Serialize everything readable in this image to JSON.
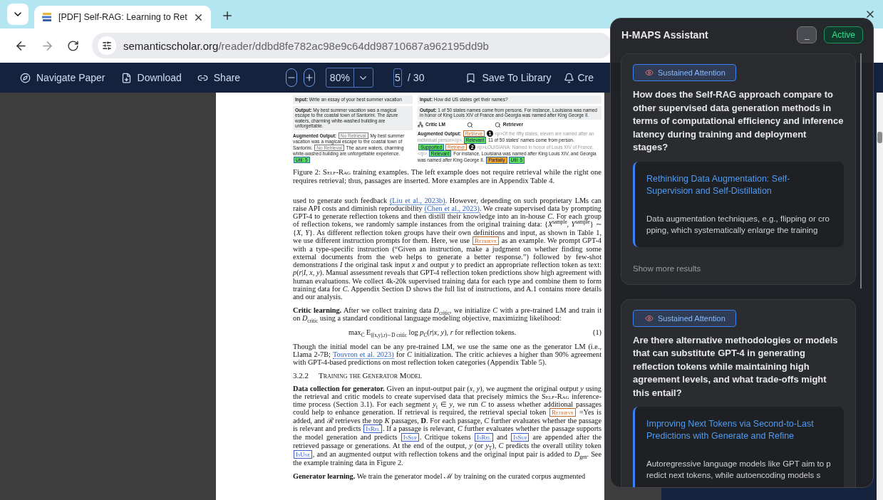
{
  "browser": {
    "tabs": [
      {
        "title": "[PDF] Self-RAG: Learning to Ret",
        "selected": true
      }
    ],
    "url_host": "semanticscholar.org",
    "url_path": "/reader/ddbd8fe782ac98e9c64dd98710687a962195dd9b"
  },
  "toolbar": {
    "left": [
      {
        "kind": "compass",
        "label": "Navigate Paper"
      },
      {
        "kind": "download",
        "label": "Download"
      },
      {
        "kind": "link",
        "label": "Share"
      }
    ],
    "zoom": "80%",
    "page": "5",
    "page_total": "/ 30",
    "right": [
      {
        "kind": "bookmark",
        "label": "Save To Library"
      },
      {
        "kind": "bell",
        "label": "Cre"
      }
    ]
  },
  "paper": {
    "figure": {
      "columns": [
        {
          "input": "**Input:** Write an essay of your best summer vacation",
          "output": "**Output:** My best summer vacation was a magical escape to the coastal town of Santorini. The azure waters, charming white-washed building are unforgettable.",
          "augmented": [
            {
              "kind": "text",
              "text": "**Augmented Output:** "
            },
            {
              "kind": "token",
              "text": "No Retrieval",
              "color": "#777777",
              "filled": false
            },
            {
              "kind": "text",
              "text": " My best summer vacation was a magical escape to the coastal town of Santorini. "
            },
            {
              "kind": "token",
              "text": "No Retrieval",
              "color": "#777777",
              "filled": false
            },
            {
              "kind": "text",
              "text": " The azure waters, charming white-washed building are unforgettable experience. "
            },
            {
              "kind": "token",
              "text": "Util: 5",
              "color": "#5fe35f",
              "filled": true
            }
          ]
        },
        {
          "input": "**Input:** How did US states get their names?",
          "output": "**Output:** 1 of 50 states names come from persons. For instance, Louisiana was named in honor of King Louis XIV of France and Georgia was named after King George II.",
          "labels": [
            {
              "kind": "critic",
              "text": "Critic LM"
            },
            {
              "kind": "retriever"
            },
            {
              "kind": "retriever",
              "text": "Retriever"
            }
          ],
          "augmented": [
            {
              "kind": "text",
              "text": "**Augmented Output:** "
            },
            {
              "kind": "token",
              "text": "Retrieve",
              "color": "#c46a2b",
              "filled": false
            },
            {
              "kind": "marker",
              "text": "1"
            },
            {
              "kind": "passage",
              "text": "<p>Of the fifty states, eleven are named after an individual person</p>."
            },
            {
              "kind": "token",
              "text": "Relevant",
              "color": "#5fe35f",
              "filled": true
            },
            {
              "kind": "text",
              "text": " 11 of 50 states' names come from person. "
            },
            {
              "kind": "token",
              "text": "Supported",
              "color": "#5fe35f",
              "filled": true
            },
            {
              "kind": "token",
              "text": "Retrieve",
              "color": "#c46a2b",
              "filled": false
            },
            {
              "kind": "marker",
              "text": "2"
            },
            {
              "kind": "passage",
              "text": "<p>LOUISIANA: Named in honor of Louis XIV of France.</p>."
            },
            {
              "kind": "token",
              "text": "Relevant",
              "color": "#5fe35f",
              "filled": true
            },
            {
              "kind": "text",
              "text": " For instance, Louisiana was named after King Louis XIV, and Georgia was named after King George II. "
            },
            {
              "kind": "token",
              "text": "Partially",
              "color": "#f5a623",
              "filled": true
            },
            {
              "kind": "token",
              "text": "Util: 5",
              "color": "#5fe35f",
              "filled": true
            }
          ]
        }
      ]
    },
    "blocks": [
      {
        "kind": "caption",
        "segments": [
          {
            "kind": "text",
            "text": "Figure 2: "
          },
          {
            "kind": "smallcaps",
            "text": "Self-Rag"
          },
          {
            "kind": "text",
            "text": " training examples. The left example does not require retrieval while the right one requires retrieval; thus, passages are inserted. More examples are in Appendix Table 4."
          }
        ]
      },
      {
        "kind": "body",
        "segments": [
          {
            "kind": "text",
            "text": "used to generate such feedback "
          },
          {
            "kind": "link",
            "text": "(Liu et al., 2023b)"
          },
          {
            "kind": "text",
            "text": ". However, depending on such proprietary LMs can raise API costs and diminish reproducibility "
          },
          {
            "kind": "link",
            "text": "(Chen et al., 2023)"
          },
          {
            "kind": "text",
            "text": ". We create supervised data by prompting GPT-4 to generate reflection tokens and then distill their knowledge into an in-house *C*. For each group of reflection tokens, we randomly sample instances from the original training data: {*X*$^{sample}$, *Y*$^{sample}$} ∼ {*X*, *Y*}. As different reflection token groups have their own definitions and input, as shown in Table 1, we use different instruction prompts for them. Here, we use "
          },
          {
            "kind": "token",
            "text": "Retrieve",
            "color": "#c46a2b"
          },
          {
            "kind": "text",
            "text": " as an example. We prompt GPT-4 with a type-specific instruction (“Given an instruction, make a judgment on whether finding some external documents from the web helps to generate a better response.”) followed by few-shot demonstrations *I* the original task input *x* and output *y* to predict an appropriate reflection token as text: *p*(*r*|*I*, *x*, *y*). Manual assessment reveals that GPT-4 reflection token predictions show high agreement with human evaluations. We collect 4k-20k supervised training data for each type and combine them to form training data for *C*. Appendix Section D shows the full list of instructions, and A.1 contains more details and our analysis."
          }
        ]
      },
      {
        "kind": "body",
        "segments": [
          {
            "kind": "text",
            "text": "**Critic learning.**  After we collect training data *D*$_{critic}$, we initialize *C* with a pre-trained LM and train it on *D*$_{critic}$ using a standard conditional language modeling objective, maximizing likelihood:"
          }
        ]
      },
      {
        "kind": "equation",
        "text": "max$_{C}$ E$_{((x,y),r)∼D critic}$ log *p*$_{C}$(*r*|*x*, *y*),  *r* for reflection tokens.",
        "number": "(1)"
      },
      {
        "kind": "body",
        "segments": [
          {
            "kind": "text",
            "text": "Though the initial model can be any pre-trained LM, we use the same one as the generator LM (i.e., Llama 2-7B; "
          },
          {
            "kind": "link",
            "text": "Touvron et al. 2023)"
          },
          {
            "kind": "text",
            "text": " for *C* initialization. The critic achieves a higher than 90% agreement with GPT-4-based predictions on most reflection token categories (Appendix Table 5)."
          }
        ]
      },
      {
        "kind": "heading",
        "number": "3.2.2",
        "text": "Training the Generator Model"
      },
      {
        "kind": "body",
        "segments": [
          {
            "kind": "text",
            "text": "**Data collection for generator.**  Given an input-output pair (*x*, *y*), we augment the original output *y* using the retrieval and critic models to create supervised data that precisely mimics the "
          },
          {
            "kind": "smallcaps",
            "text": "Self-Rag"
          },
          {
            "kind": "text",
            "text": " inference-time process (Section 3.1). For each segment *y*$_{t}$ ∈ *y*, we run *C* to assess whether additional passages could help to enhance generation. If retrieval is required, the retrieval special token "
          },
          {
            "kind": "token",
            "text": "Retrieve",
            "color": "#c46a2b"
          },
          {
            "kind": "text",
            "text": " =Yes is added, and ℛ retrieves the top *K* passages, **D**. For each passage, *C* further evaluates whether the passage is relevant and predicts "
          },
          {
            "kind": "token",
            "text": "IsRel",
            "color": "#3b5fc4"
          },
          {
            "kind": "text",
            "text": ". If a passage is relevant, *C* further evaluates whether the passage supports the model generation and predicts "
          },
          {
            "kind": "token",
            "text": "IsSup",
            "color": "#3b5fc4"
          },
          {
            "kind": "text",
            "text": ". Critique tokens "
          },
          {
            "kind": "token",
            "text": "IsRel",
            "color": "#3b5fc4"
          },
          {
            "kind": "text",
            "text": " and "
          },
          {
            "kind": "token",
            "text": "IsSup",
            "color": "#3b5fc4"
          },
          {
            "kind": "text",
            "text": " are appended after the retrieved passage or generations. At the end of the output, *y* (or *y*$_{T}$), *C* predicts the overall utility token "
          },
          {
            "kind": "token",
            "text": "IsUse",
            "color": "#3b5fc4"
          },
          {
            "kind": "text",
            "text": ", and an augmented output with reflection tokens and the original input pair is added to *D*$_{gen}$. See the example training data in Figure 2."
          }
        ]
      },
      {
        "kind": "body",
        "segments": [
          {
            "kind": "text",
            "text": "**Generator learning.** We train the generator model ℳ by training on the curated corpus augmented"
          }
        ]
      }
    ]
  },
  "assistant": {
    "title": "H-MAPS Assistant",
    "minimize": "_",
    "status": "Active",
    "cards": [
      {
        "tag": "Sustained Attention",
        "question": "How does the Self-RAG approach compare to other supervised data generation methods in terms of computational efficiency and inference latency during training and deployment stages?",
        "result": {
          "title": "Rethinking Data Augmentation: Self-Supervision and Self-Distillation",
          "snippet": "Data augmentation techniques, e.g., flipping or cropping, which systematically enlarge the training"
        },
        "more": "Show more results"
      },
      {
        "tag": "Sustained Attention",
        "question": "Are there alternative methodologies or models that can substitute GPT-4 in generating reflection tokens while maintaining high agreement levels, and what trade-offs might this entail?",
        "result": {
          "title": "Improving Next Tokens via Second-to-Last Predictions with Generate and Refine",
          "snippet": "Autoregressive language models like GPT aim to predict next tokens, while autoencoding models s"
        }
      }
    ]
  }
}
